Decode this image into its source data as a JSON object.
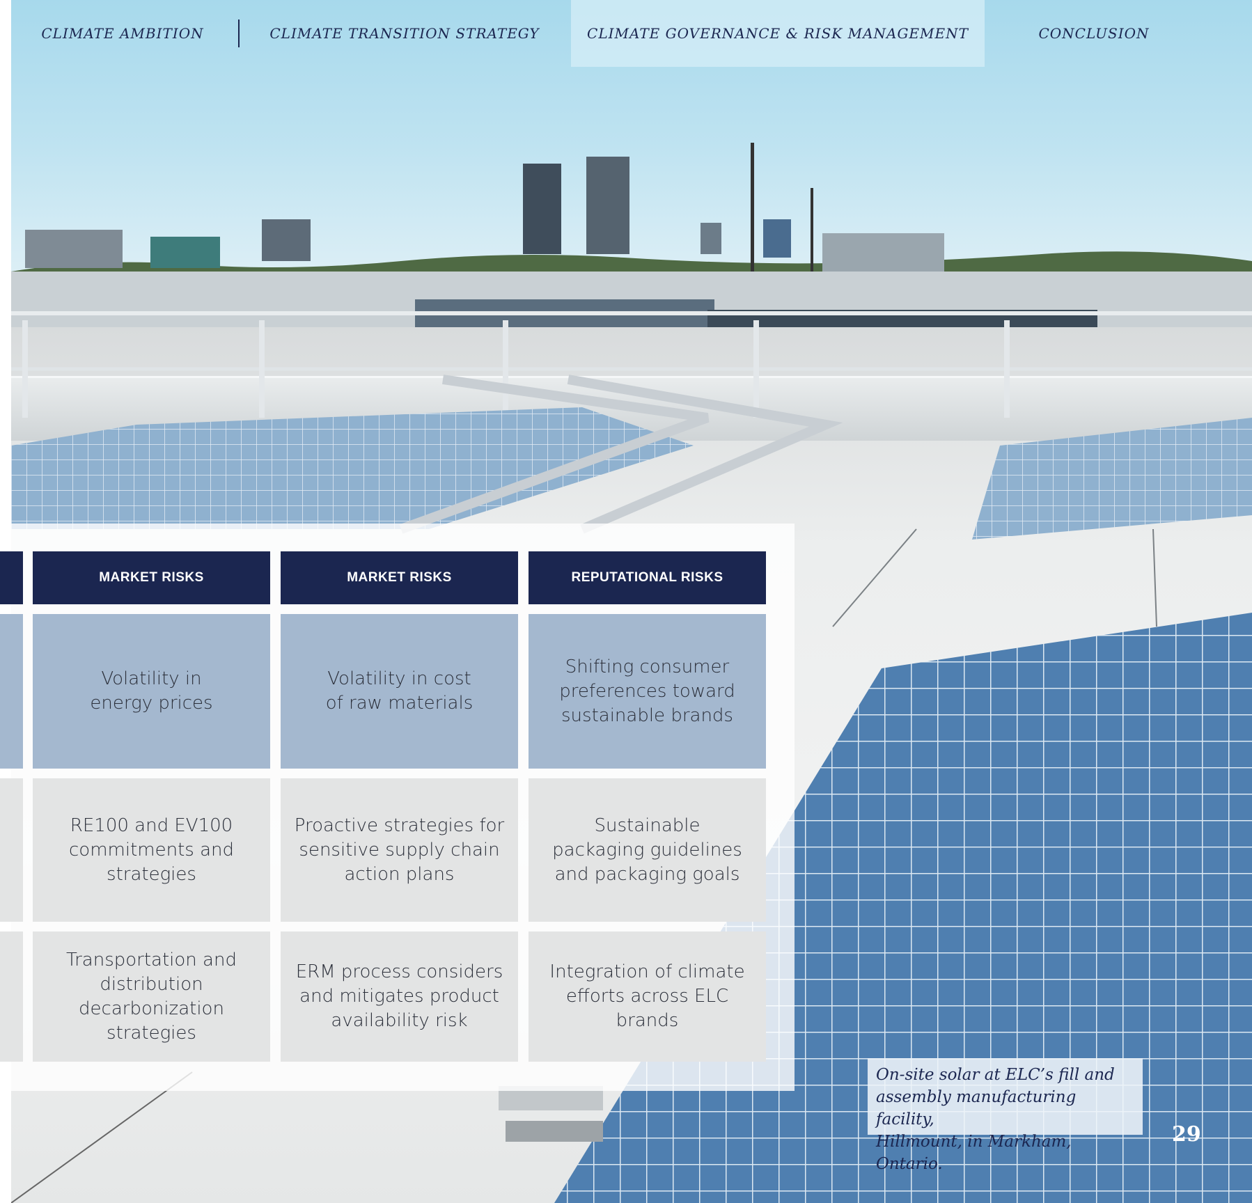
{
  "nav": {
    "items": [
      "CLIMATE AMBITION",
      "CLIMATE TRANSITION STRATEGY",
      "CLIMATE  GOVERNANCE & RISK MANAGEMENT",
      "CONCLUSION"
    ],
    "active_index": 2
  },
  "table": {
    "headers": [
      "MARKET RISKS",
      "MARKET RISKS",
      "REPUTATIONAL RISKS"
    ],
    "rows": [
      [
        "Volatility in\nenergy prices",
        "Volatility in cost\nof raw materials",
        "Shifting consumer\npreferences toward\nsustainable brands"
      ],
      [
        "RE100 and EV100\ncommitments and\nstrategies",
        "Proactive strategies for\nsensitive supply chain\naction plans",
        "Sustainable\npackaging guidelines\nand packaging goals"
      ],
      [
        "Transportation and\ndistribution\ndecarbonization\nstrategies",
        "ERM process considers\nand mitigates product\navailability risk",
        "Integration of climate\nefforts across ELC brands"
      ]
    ]
  },
  "caption": "On-site solar at ELC’s fill and\nassembly manufacturing facility,\nHillmount, in Markham, Ontario.",
  "page_number": "29",
  "colors": {
    "navy": "#1b2650",
    "header_bg": "#1b2650",
    "row1_bg": "#a4b8cf",
    "row_gray_bg": "#e3e4e4"
  },
  "icons": {
    "photo": "rooftop-solar-photo"
  }
}
